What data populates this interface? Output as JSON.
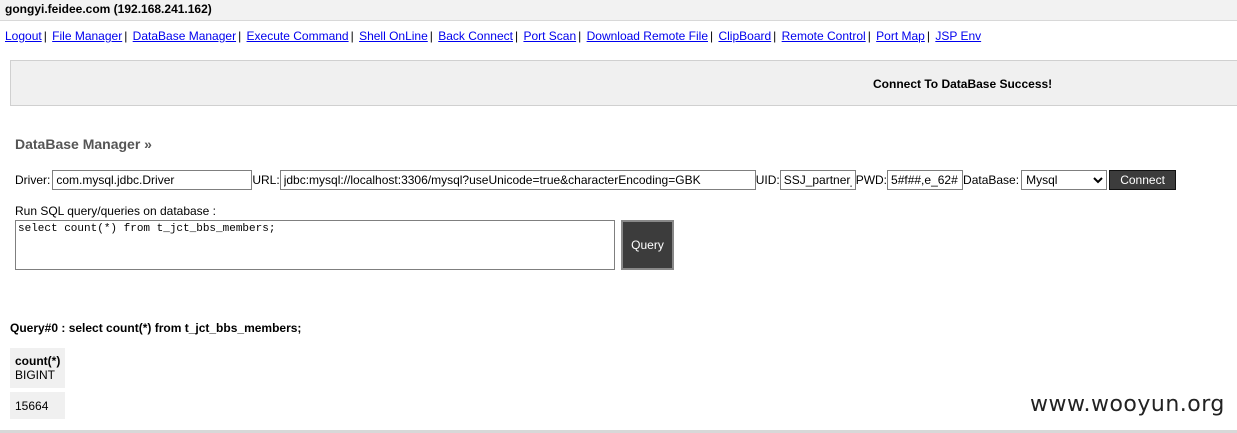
{
  "header": {
    "title": "gongyi.feidee.com (192.168.241.162)"
  },
  "nav": [
    "Logout",
    "File Manager",
    "DataBase Manager",
    "Execute Command",
    "Shell OnLine",
    "Back Connect",
    "Port Scan",
    "Download Remote File",
    "ClipBoard",
    "Remote Control",
    "Port Map",
    "JSP Env"
  ],
  "status": {
    "message": "Connect To DataBase Success!"
  },
  "db": {
    "heading": "DataBase Manager »",
    "driver_label": "Driver:",
    "driver_value": "com.mysql.jdbc.Driver",
    "url_label": "URL:",
    "url_value": "jdbc:mysql://localhost:3306/mysql?useUnicode=true&characterEncoding=GBK",
    "uid_label": "UID:",
    "uid_value": "SSJ_partner_",
    "pwd_label": "PWD:",
    "pwd_value": "5#f##,e_62#",
    "database_label": "DataBase:",
    "database_selected": "Mysql",
    "connect_label": "Connect",
    "sql_label": "Run SQL query/queries on database :",
    "sql_value": "select count(*) from t_jct_bbs_members;",
    "query_label": "Query"
  },
  "result": {
    "title": "Query#0 : select count(*) from t_jct_bbs_members;",
    "column_name": "count(*)",
    "column_type": "BIGINT",
    "rows": [
      "15664"
    ]
  },
  "watermark": "www.wooyun.org"
}
